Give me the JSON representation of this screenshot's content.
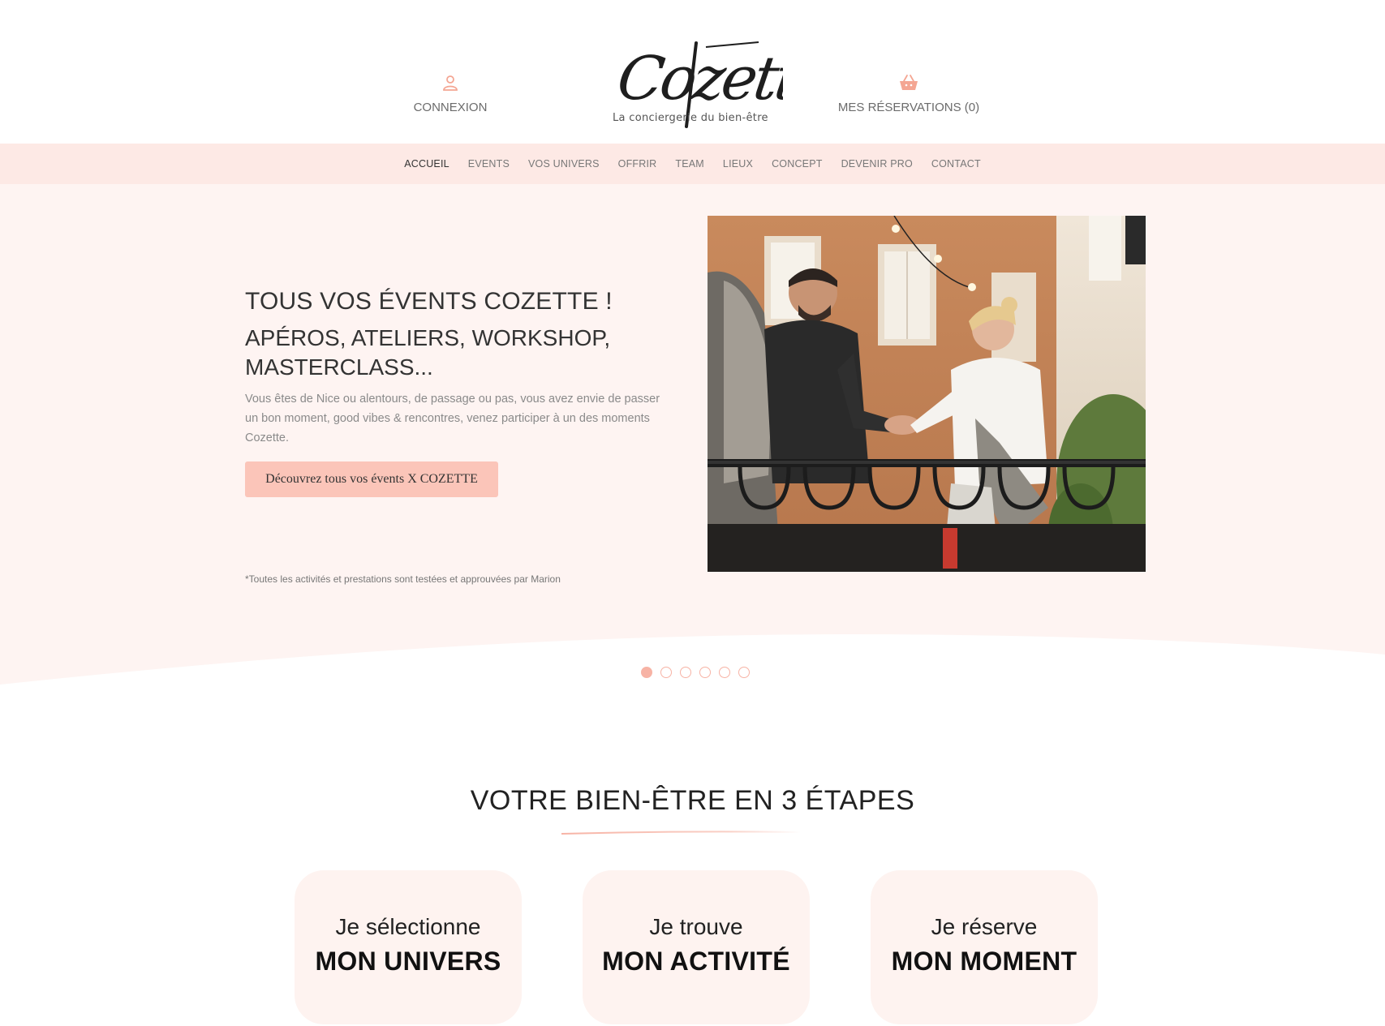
{
  "header": {
    "account_label": "CONNEXION",
    "cart_label": "MES RÉSERVATIONS (0)",
    "logo_text": "Cozette",
    "logo_tagline": "La conciergerie du bien-être"
  },
  "nav": {
    "items": [
      "ACCUEIL",
      "EVENTS",
      "VOS UNIVERS",
      "OFFRIR",
      "TEAM",
      "LIEUX",
      "CONCEPT",
      "DEVENIR PRO",
      "CONTACT"
    ],
    "active": "ACCUEIL"
  },
  "hero": {
    "title_line1": "TOUS VOS ÉVENTS COZETTE !",
    "title_line2": "APÉROS, ATELIERS, WORKSHOP, MASTERCLASS...",
    "description": "Vous êtes de Nice ou alentours, de passage ou pas, vous avez envie de passer un bon moment, good vibes & rencontres, venez participer à un des moments Cozette.",
    "cta_label": "Découvrez tous vos évents X COZETTE",
    "footnote": "*Toutes les activités et prestations sont testées et approuvées par Marion",
    "slides_count": 6,
    "active_slide": 1
  },
  "steps": {
    "title": "VOTRE BIEN-ÊTRE EN 3 ÉTAPES",
    "cards": [
      {
        "line1": "Je sélectionne",
        "line2": "MON UNIVERS"
      },
      {
        "line1": "Je trouve",
        "line2": "MON ACTIVITÉ"
      },
      {
        "line1": "Je réserve",
        "line2": "MON MOMENT"
      }
    ]
  },
  "colors": {
    "accent": "#fbc5b9",
    "nav_bg": "#fde9e5",
    "hero_bg": "#fef4f2",
    "card_bg": "#fef3f0"
  },
  "icons": {
    "account": "user-icon",
    "cart": "basket-icon"
  }
}
